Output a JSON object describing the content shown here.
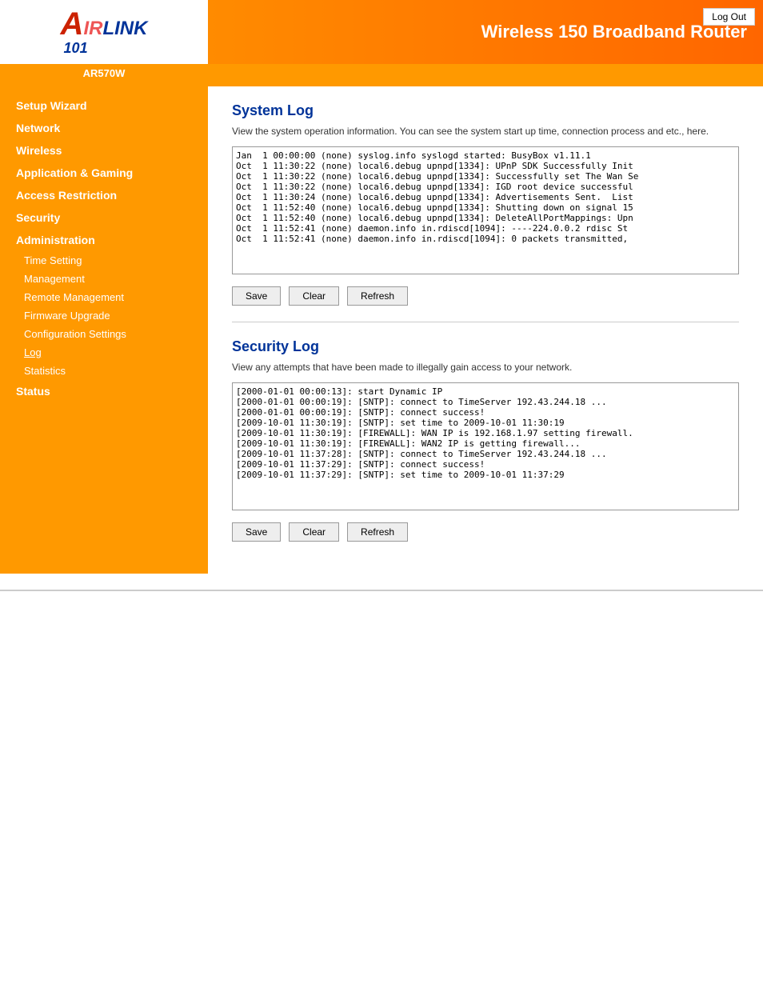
{
  "header": {
    "title": "Wireless 150 Broadband Router",
    "logout_label": "Log Out",
    "model": "AR570W"
  },
  "sidebar": {
    "items": [
      {
        "label": "Setup Wizard",
        "key": "setup-wizard",
        "sub": []
      },
      {
        "label": "Network",
        "key": "network",
        "sub": []
      },
      {
        "label": "Wireless",
        "key": "wireless",
        "sub": []
      },
      {
        "label": "Application & Gaming",
        "key": "app-gaming",
        "sub": []
      },
      {
        "label": "Access Restriction",
        "key": "access-restriction",
        "sub": []
      },
      {
        "label": "Security",
        "key": "security",
        "sub": []
      },
      {
        "label": "Administration",
        "key": "administration",
        "sub": [
          "Time Setting",
          "Management",
          "Remote Management",
          "Firmware Upgrade",
          "Configuration Settings",
          "Log",
          "Statistics"
        ]
      },
      {
        "label": "Status",
        "key": "status",
        "sub": []
      }
    ]
  },
  "system_log": {
    "title": "System Log",
    "description": "View the system operation information. You can see the system start up time, connection process and etc., here.",
    "content": "Jan  1 00:00:00 (none) syslog.info syslogd started: BusyBox v1.11.1\nOct  1 11:30:22 (none) local6.debug upnpd[1334]: UPnP SDK Successfully Init\nOct  1 11:30:22 (none) local6.debug upnpd[1334]: Successfully set The Wan Se\nOct  1 11:30:22 (none) local6.debug upnpd[1334]: IGD root device successful\nOct  1 11:30:24 (none) local6.debug upnpd[1334]: Advertisements Sent.  List\nOct  1 11:52:40 (none) local6.debug upnpd[1334]: Shutting down on signal 15\nOct  1 11:52:40 (none) local6.debug upnpd[1334]: DeleteAllPortMappings: Upn\nOct  1 11:52:41 (none) daemon.info in.rdiscd[1094]: ----224.0.0.2 rdisc St\nOct  1 11:52:41 (none) daemon.info in.rdiscd[1094]: 0 packets transmitted,",
    "save_label": "Save",
    "clear_label": "Clear",
    "refresh_label": "Refresh"
  },
  "security_log": {
    "title": "Security Log",
    "description": "View any attempts that have been made to illegally gain access to your network.",
    "content": "[2000-01-01 00:00:13]: start Dynamic IP\n[2000-01-01 00:00:19]: [SNTP]: connect to TimeServer 192.43.244.18 ...\n[2000-01-01 00:00:19]: [SNTP]: connect success!\n[2009-10-01 11:30:19]: [SNTP]: set time to 2009-10-01 11:30:19\n[2009-10-01 11:30:19]: [FIREWALL]: WAN IP is 192.168.1.97 setting firewall.\n[2009-10-01 11:30:19]: [FIREWALL]: WAN2 IP is getting firewall...\n[2009-10-01 11:37:28]: [SNTP]: connect to TimeServer 192.43.244.18 ...\n[2009-10-01 11:37:29]: [SNTP]: connect success!\n[2009-10-01 11:37:29]: [SNTP]: set time to 2009-10-01 11:37:29",
    "save_label": "Save",
    "clear_label": "Clear",
    "refresh_label": "Refresh"
  }
}
